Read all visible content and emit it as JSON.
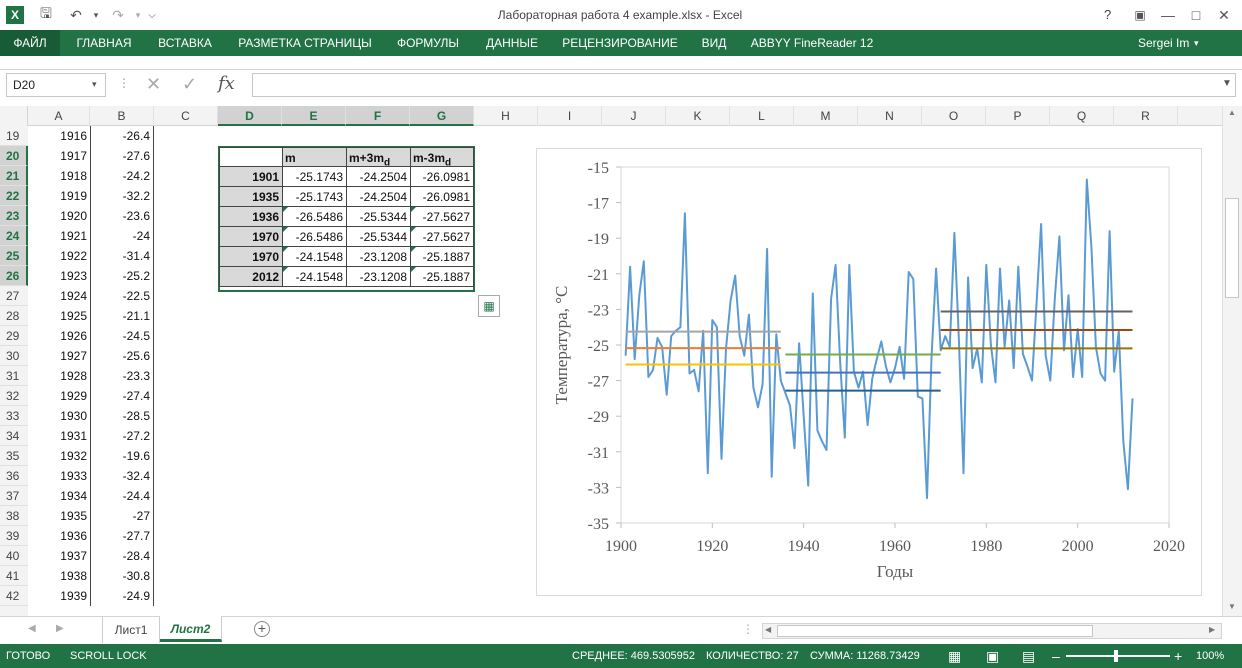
{
  "window": {
    "title": "Лабораторная работа 4 example.xlsx - Excel",
    "help": "?",
    "user": "Sergei Im"
  },
  "ribbon": {
    "tabs": [
      "ФАЙЛ",
      "ГЛАВНАЯ",
      "ВСТАВКА",
      "РАЗМЕТКА СТРАНИЦЫ",
      "ФОРМУЛЫ",
      "ДАННЫЕ",
      "РЕЦЕНЗИРОВАНИЕ",
      "ВИД",
      "ABBYY FineReader 12"
    ]
  },
  "formula": {
    "name_box": "D20",
    "fx": "fx",
    "value": ""
  },
  "columns": [
    "A",
    "B",
    "C",
    "D",
    "E",
    "F",
    "G",
    "H",
    "I",
    "J",
    "K",
    "L",
    "M",
    "N",
    "O",
    "P",
    "Q",
    "R"
  ],
  "rows": [
    {
      "n": "19",
      "a": "1916",
      "b": "-26.4"
    },
    {
      "n": "20",
      "a": "1917",
      "b": "-27.6"
    },
    {
      "n": "21",
      "a": "1918",
      "b": "-24.2"
    },
    {
      "n": "22",
      "a": "1919",
      "b": "-32.2"
    },
    {
      "n": "23",
      "a": "1920",
      "b": "-23.6"
    },
    {
      "n": "24",
      "a": "1921",
      "b": "-24"
    },
    {
      "n": "25",
      "a": "1922",
      "b": "-31.4"
    },
    {
      "n": "26",
      "a": "1923",
      "b": "-25.2"
    },
    {
      "n": "27",
      "a": "1924",
      "b": "-22.5"
    },
    {
      "n": "28",
      "a": "1925",
      "b": "-21.1"
    },
    {
      "n": "29",
      "a": "1926",
      "b": "-24.5"
    },
    {
      "n": "30",
      "a": "1927",
      "b": "-25.6"
    },
    {
      "n": "31",
      "a": "1928",
      "b": "-23.3"
    },
    {
      "n": "32",
      "a": "1929",
      "b": "-27.4"
    },
    {
      "n": "33",
      "a": "1930",
      "b": "-28.5"
    },
    {
      "n": "34",
      "a": "1931",
      "b": "-27.2"
    },
    {
      "n": "35",
      "a": "1932",
      "b": "-19.6"
    },
    {
      "n": "36",
      "a": "1933",
      "b": "-32.4"
    },
    {
      "n": "37",
      "a": "1934",
      "b": "-24.4"
    },
    {
      "n": "38",
      "a": "1935",
      "b": "-27"
    },
    {
      "n": "39",
      "a": "1936",
      "b": "-27.7"
    },
    {
      "n": "40",
      "a": "1937",
      "b": "-28.4"
    },
    {
      "n": "41",
      "a": "1938",
      "b": "-30.8"
    },
    {
      "n": "42",
      "a": "1939",
      "b": "-24.9"
    }
  ],
  "table": {
    "headers": [
      "m",
      "m+3m",
      "m-3m"
    ],
    "subscript": "d",
    "rows": [
      {
        "year": "1901",
        "m": "-25.1743",
        "p": "-24.2504",
        "q": "-26.0981"
      },
      {
        "year": "1935",
        "m": "-25.1743",
        "p": "-24.2504",
        "q": "-26.0981"
      },
      {
        "year": "1936",
        "m": "-26.5486",
        "p": "-25.5344",
        "q": "-27.5627"
      },
      {
        "year": "1970",
        "m": "-26.5486",
        "p": "-25.5344",
        "q": "-27.5627"
      },
      {
        "year": "1970",
        "m": "-24.1548",
        "p": "-23.1208",
        "q": "-25.1887"
      },
      {
        "year": "2012",
        "m": "-24.1548",
        "p": "-23.1208",
        "q": "-25.1887"
      }
    ]
  },
  "chart_data": {
    "type": "line",
    "xlabel": "Годы",
    "ylabel": "Температура, °C",
    "xlim": [
      1900,
      2020
    ],
    "ylim": [
      -35,
      -15
    ],
    "xticks": [
      1900,
      1920,
      1940,
      1960,
      1980,
      2000,
      2020
    ],
    "yticks": [
      -15,
      -17,
      -19,
      -21,
      -23,
      -25,
      -27,
      -29,
      -31,
      -33,
      -35
    ],
    "series_color": "#5b9bd5",
    "x": [
      1901,
      1902,
      1903,
      1904,
      1905,
      1906,
      1907,
      1908,
      1909,
      1910,
      1911,
      1912,
      1913,
      1914,
      1915,
      1916,
      1917,
      1918,
      1919,
      1920,
      1921,
      1922,
      1923,
      1924,
      1925,
      1926,
      1927,
      1928,
      1929,
      1930,
      1931,
      1932,
      1933,
      1934,
      1935,
      1936,
      1937,
      1938,
      1939,
      1940,
      1941,
      1942,
      1943,
      1944,
      1945,
      1946,
      1947,
      1948,
      1949,
      1950,
      1951,
      1952,
      1953,
      1954,
      1955,
      1956,
      1957,
      1958,
      1959,
      1960,
      1961,
      1962,
      1963,
      1964,
      1965,
      1966,
      1967,
      1968,
      1969,
      1970,
      1971,
      1972,
      1973,
      1974,
      1975,
      1976,
      1977,
      1978,
      1979,
      1980,
      1981,
      1982,
      1983,
      1984,
      1985,
      1986,
      1987,
      1988,
      1989,
      1990,
      1991,
      1992,
      1993,
      1994,
      1995,
      1996,
      1997,
      1998,
      1999,
      2000,
      2001,
      2002,
      2003,
      2004,
      2005,
      2006,
      2007,
      2008,
      2009,
      2010,
      2011,
      2012
    ],
    "y": [
      -25.6,
      -20.6,
      -25.8,
      -22.2,
      -20.3,
      -26.8,
      -26.4,
      -24.6,
      -25.1,
      -27.8,
      -24.5,
      -24.2,
      -24.0,
      -17.6,
      -26.6,
      -26.4,
      -27.6,
      -24.2,
      -32.2,
      -23.6,
      -24.0,
      -31.4,
      -25.2,
      -22.5,
      -21.1,
      -24.5,
      -25.6,
      -23.3,
      -27.4,
      -28.5,
      -27.2,
      -19.6,
      -32.4,
      -24.4,
      -27.0,
      -27.7,
      -28.4,
      -30.8,
      -24.9,
      -29.0,
      -32.9,
      -22.1,
      -29.8,
      -30.4,
      -30.9,
      -22.4,
      -20.5,
      -26.0,
      -30.2,
      -20.5,
      -26.5,
      -27.4,
      -26.5,
      -29.5,
      -26.9,
      -25.8,
      -24.8,
      -26.2,
      -27.1,
      -26.3,
      -25.1,
      -26.9,
      -20.9,
      -21.3,
      -27.9,
      -28.0,
      -33.6,
      -25.7,
      -20.7,
      -25.3,
      -24.5,
      -25.1,
      -18.7,
      -24.7,
      -32.2,
      -21.2,
      -26.3,
      -25.2,
      -27.1,
      -20.5,
      -25.0,
      -27.1,
      -20.7,
      -25.1,
      -22.5,
      -26.3,
      -20.6,
      -25.5,
      -26.2,
      -27.0,
      -22.6,
      -18.2,
      -25.6,
      -27.0,
      -22.4,
      -18.9,
      -25.3,
      -22.2,
      -26.8,
      -24.1,
      -26.8,
      -15.7,
      -19.5,
      -25.1,
      -26.6,
      -27.0,
      -18.6,
      -26.5,
      -24.2,
      -30.4,
      -33.1,
      -28.0
    ],
    "segments": [
      {
        "x": [
          1901,
          1935
        ],
        "y": -24.2504,
        "color": "#a5a5a5"
      },
      {
        "x": [
          1901,
          1935
        ],
        "y": -25.1743,
        "color": "#ed7d31"
      },
      {
        "x": [
          1901,
          1935
        ],
        "y": -26.0981,
        "color": "#ffc000"
      },
      {
        "x": [
          1936,
          1970
        ],
        "y": -25.5344,
        "color": "#70ad47"
      },
      {
        "x": [
          1936,
          1970
        ],
        "y": -26.5486,
        "color": "#4472c4"
      },
      {
        "x": [
          1936,
          1970
        ],
        "y": -27.5627,
        "color": "#255e91"
      },
      {
        "x": [
          1970,
          2012
        ],
        "y": -23.1208,
        "color": "#636363"
      },
      {
        "x": [
          1970,
          2012
        ],
        "y": -24.1548,
        "color": "#9e480e"
      },
      {
        "x": [
          1970,
          2012
        ],
        "y": -25.1887,
        "color": "#997300"
      }
    ]
  },
  "sheets": {
    "tabs": [
      "Лист1",
      "Лист2"
    ],
    "active": 1
  },
  "status": {
    "ready": "ГОТОВО",
    "scroll": "SCROLL LOCK",
    "avg": "СРЕДНЕЕ: 469.5305952",
    "count": "КОЛИЧЕСТВО: 27",
    "sum": "СУММА: 11268.73429",
    "zoom": "100%"
  }
}
